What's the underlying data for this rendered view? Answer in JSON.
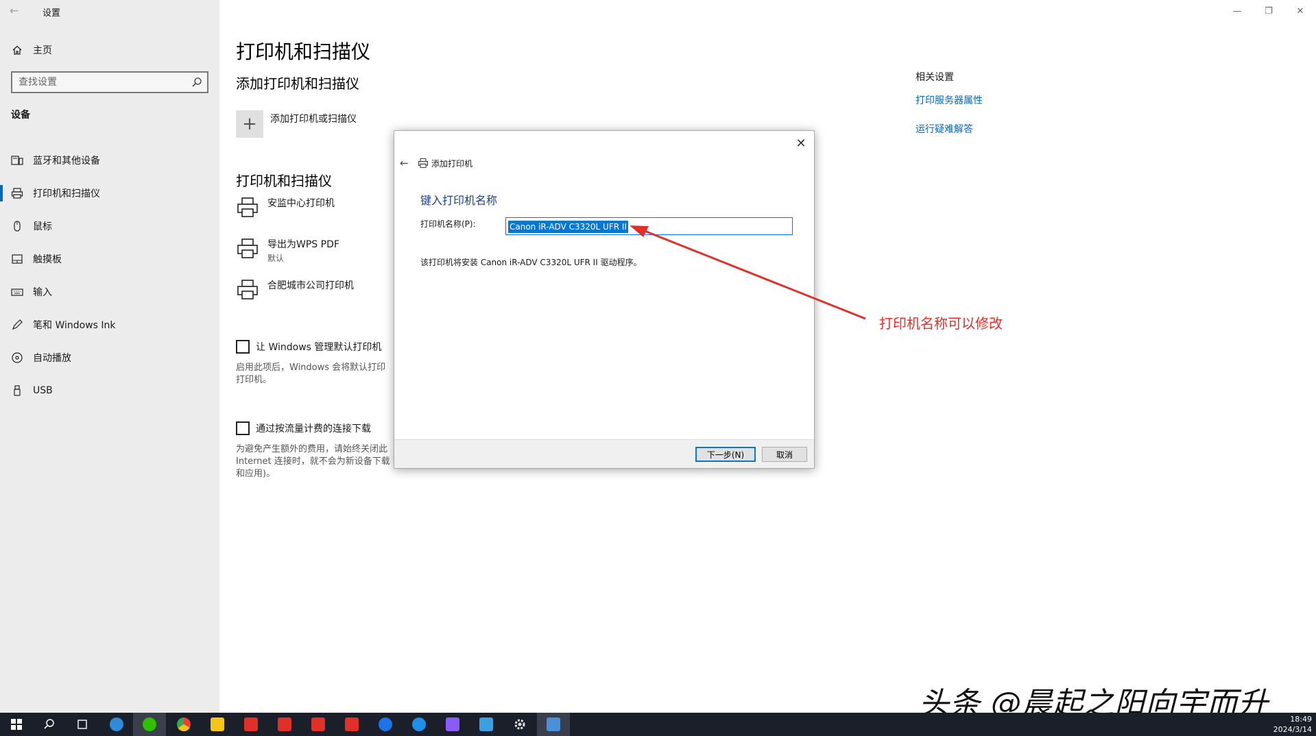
{
  "window": {
    "title": "设置",
    "minimize": "—",
    "restore": "❐",
    "close": "✕"
  },
  "sidebar": {
    "home_label": "主页",
    "search_placeholder": "查找设置",
    "section": "设备",
    "items": [
      {
        "label": "蓝牙和其他设备",
        "icon": "bluetooth-devices-icon"
      },
      {
        "label": "打印机和扫描仪",
        "icon": "printer-icon",
        "active": true
      },
      {
        "label": "鼠标",
        "icon": "mouse-icon"
      },
      {
        "label": "触摸板",
        "icon": "touchpad-icon"
      },
      {
        "label": "输入",
        "icon": "keyboard-icon"
      },
      {
        "label": "笔和 Windows Ink",
        "icon": "pen-icon"
      },
      {
        "label": "自动播放",
        "icon": "autoplay-icon"
      },
      {
        "label": "USB",
        "icon": "usb-icon"
      }
    ]
  },
  "main": {
    "title": "打印机和扫描仪",
    "add_section_title": "添加打印机和扫描仪",
    "add_label": "添加打印机或扫描仪",
    "list_title": "打印机和扫描仪",
    "printers": [
      {
        "name": "安监中心打印机",
        "sub": ""
      },
      {
        "name": "导出为WPS PDF",
        "sub": "默认"
      },
      {
        "name": "合肥城市公司打印机",
        "sub": ""
      }
    ],
    "option1": {
      "label": "让 Windows 管理默认打印机",
      "desc": "启用此项后，Windows 会将默认打印机设置为你最近使用的打印机。",
      "desc_visible": "启用此项后，Windows 会将默认打印\n打印机。"
    },
    "option2": {
      "label": "通过按流量计费的连接下载",
      "desc_visible": "为避免产生额外的费用，请始终关闭此\nInternet 连接时，就不会为新设备下载\n和应用)。"
    },
    "related": {
      "title": "相关设置",
      "links": [
        "打印服务器属性",
        "运行疑难解答"
      ]
    }
  },
  "dialog": {
    "header": "添加打印机",
    "heading": "键入打印机名称",
    "field_label": "打印机名称(P):",
    "field_value": "Canon iR-ADV C3320L UFR II",
    "info": "该打印机将安装 Canon iR-ADV C3320L UFR II 驱动程序。",
    "next_button": "下一步(N)",
    "cancel_button": "取消",
    "close": "✕",
    "back": "←"
  },
  "annotation": {
    "text": "打印机名称可以修改",
    "color": "#e0302a"
  },
  "watermark": "头条 @晨起之阳向宇而升",
  "taskbar": {
    "time": "18:49",
    "date": "2024/3/14",
    "apps": [
      {
        "name": "start-icon",
        "color": "#ffffff"
      },
      {
        "name": "search-icon",
        "color": "#ffffff"
      },
      {
        "name": "task-view-icon",
        "color": "#ffffff"
      },
      {
        "name": "app-icon-1",
        "color": "#2e8bd8"
      },
      {
        "name": "wechat-icon",
        "color": "#2dc100"
      },
      {
        "name": "chrome-icon",
        "color": "#e94235"
      },
      {
        "name": "file-explorer-icon",
        "color": "#f5c518"
      },
      {
        "name": "wps-icon-1",
        "color": "#e0302a"
      },
      {
        "name": "wps-icon-2",
        "color": "#e0302a"
      },
      {
        "name": "wps-icon-3",
        "color": "#e0302a"
      },
      {
        "name": "wps-icon-4",
        "color": "#e0302a"
      },
      {
        "name": "app-icon-2",
        "color": "#1e73e8"
      },
      {
        "name": "app-icon-3",
        "color": "#1e90e8"
      },
      {
        "name": "photos-icon",
        "color": "#8a5cf6"
      },
      {
        "name": "app-icon-4",
        "color": "#3aa0e0"
      },
      {
        "name": "settings-icon",
        "color": "#dddddd"
      },
      {
        "name": "control-panel-icon",
        "color": "#4a90d9"
      }
    ]
  }
}
